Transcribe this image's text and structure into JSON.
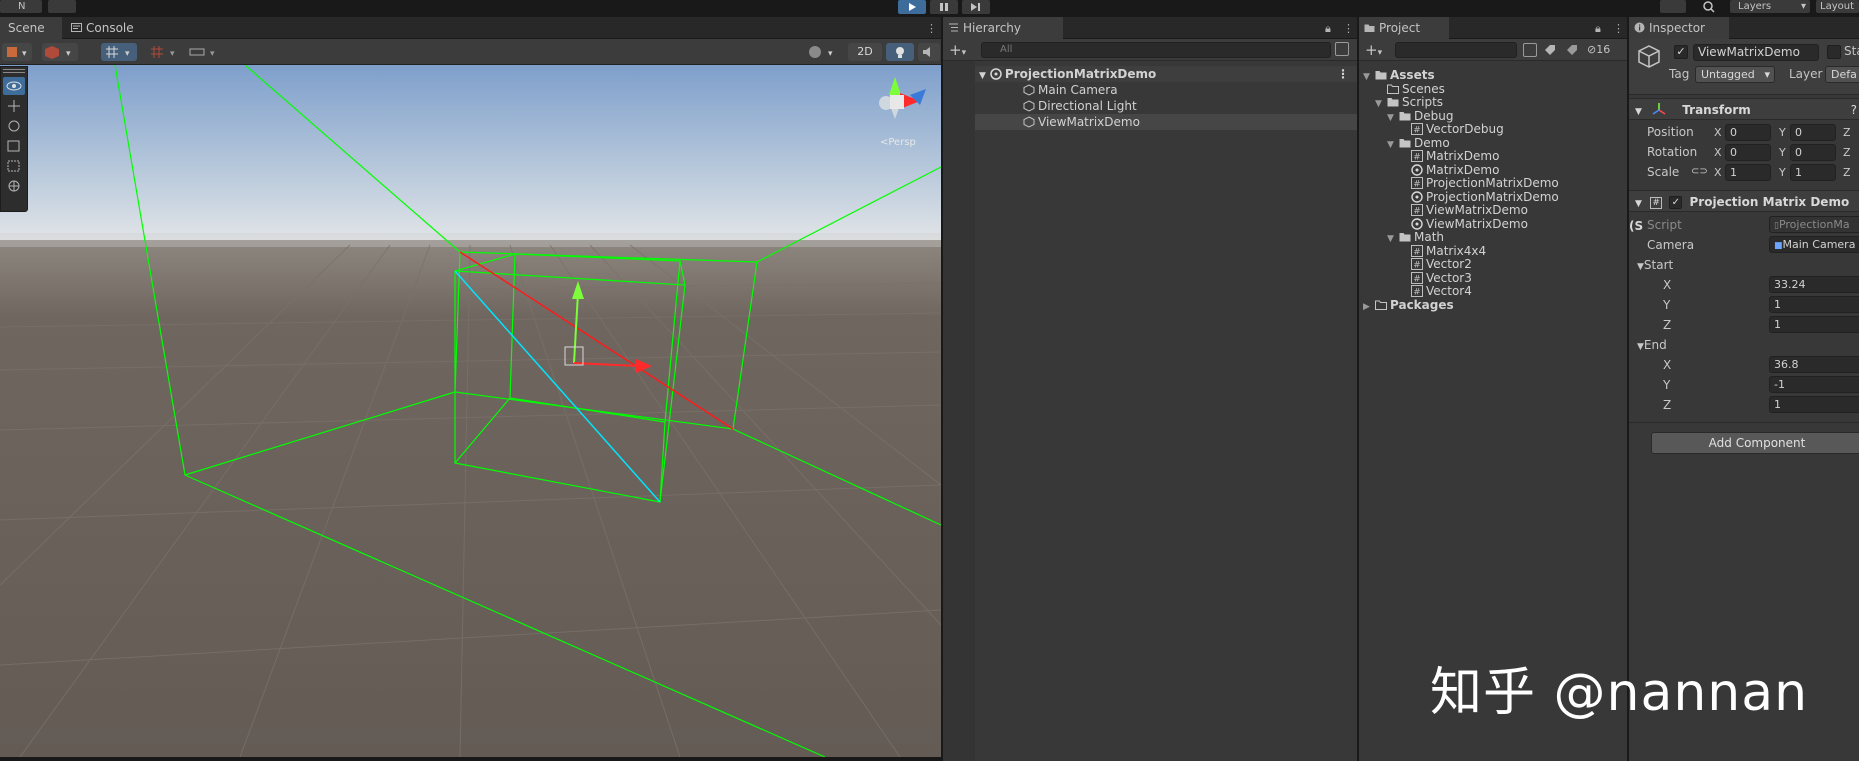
{
  "topbar": {
    "account_label": "N",
    "layers_label": "Layers",
    "layout_label": "Layout"
  },
  "tabs": {
    "scene": "Scene",
    "console": "Console",
    "hierarchy": "Hierarchy",
    "project": "Project",
    "inspector": "Inspector"
  },
  "scene_toolbar": {
    "mode_2d": "2D"
  },
  "hierarchy": {
    "search_placeholder": "All",
    "scene_root": "ProjectionMatrixDemo",
    "objects": [
      "Main Camera",
      "Directional Light",
      "ViewMatrixDemo"
    ]
  },
  "project": {
    "hidden_count": "16",
    "tree": [
      {
        "label": "Assets",
        "bold": true,
        "kind": "folder-open"
      },
      {
        "label": "Scenes",
        "kind": "folder"
      },
      {
        "label": "Scripts",
        "kind": "folder-open"
      },
      {
        "label": "Debug",
        "kind": "folder-open"
      },
      {
        "label": "VectorDebug",
        "kind": "script"
      },
      {
        "label": "Demo",
        "kind": "folder-open"
      },
      {
        "label": "MatrixDemo",
        "kind": "script"
      },
      {
        "label": "MatrixDemo",
        "kind": "scene"
      },
      {
        "label": "ProjectionMatrixDemo",
        "kind": "script"
      },
      {
        "label": "ProjectionMatrixDemo",
        "kind": "scene"
      },
      {
        "label": "ViewMatrixDemo",
        "kind": "script"
      },
      {
        "label": "ViewMatrixDemo",
        "kind": "scene"
      },
      {
        "label": "Math",
        "kind": "folder-open"
      },
      {
        "label": "Matrix4x4",
        "kind": "script"
      },
      {
        "label": "Vector2",
        "kind": "script"
      },
      {
        "label": "Vector3",
        "kind": "script"
      },
      {
        "label": "Vector4",
        "kind": "script"
      },
      {
        "label": "Packages",
        "bold": true,
        "kind": "folder"
      }
    ]
  },
  "inspector": {
    "object_name": "ViewMatrixDemo",
    "static_label": "Sta",
    "tag_label": "Tag",
    "tag_value": "Untagged",
    "layer_label": "Layer",
    "layer_value": "Defa",
    "transform": {
      "title": "Transform",
      "position_label": "Position",
      "rotation_label": "Rotation",
      "scale_label": "Scale",
      "position": {
        "x": "0",
        "y": "0"
      },
      "rotation": {
        "x": "0",
        "y": "0"
      },
      "scale": {
        "x": "1",
        "y": "1"
      }
    },
    "component": {
      "title": "Projection Matrix Demo (S",
      "script_label": "Script",
      "script_value": "ProjectionMa",
      "camera_label": "Camera",
      "camera_value": "Main Camera",
      "start_label": "Start",
      "start": {
        "x": "33.24",
        "y": "1",
        "z": "1"
      },
      "end_label": "End",
      "end": {
        "x": "36.8",
        "y": "-1",
        "z": "1"
      }
    },
    "add_component": "Add Component",
    "axis_x": "X",
    "axis_y": "Y",
    "axis_z": "Z"
  },
  "watermark": "知乎 @nannan",
  "colors": {
    "accent": "#3e6d9c",
    "frustum": "#00ff00",
    "ray": "#ff0000",
    "diagonal": "#00e5ff"
  }
}
